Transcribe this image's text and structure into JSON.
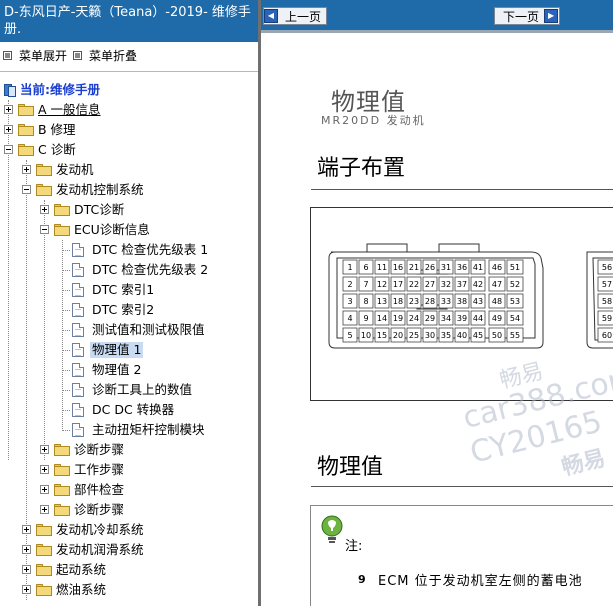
{
  "left_panel": {
    "title": "D-东风日产-天籁（Teana）-2019- 维修手册.",
    "menu": {
      "expand_label": "菜单展开",
      "collapse_label": "菜单折叠"
    },
    "tree": {
      "root_label": "当前:维修手册",
      "items": [
        {
          "label": "A 一般信息"
        },
        {
          "label": "B 修理"
        },
        {
          "label": "C 诊断"
        },
        {
          "label": "发动机"
        },
        {
          "label": "发动机控制系统"
        },
        {
          "label": "DTC诊断"
        },
        {
          "label": "ECU诊断信息"
        },
        {
          "label": "DTC 检查优先级表 1"
        },
        {
          "label": "DTC 检查优先级表 2"
        },
        {
          "label": "DTC 索引1"
        },
        {
          "label": "DTC 索引2"
        },
        {
          "label": "测试值和测试极限值"
        },
        {
          "label": "物理值 1"
        },
        {
          "label": "物理值 2"
        },
        {
          "label": "诊断工具上的数值"
        },
        {
          "label": "DC DC 转换器"
        },
        {
          "label": "主动扭矩杆控制模块"
        },
        {
          "label": "诊断步骤"
        },
        {
          "label": "工作步骤"
        },
        {
          "label": "部件检查"
        },
        {
          "label": "诊断步骤"
        },
        {
          "label": "发动机冷却系统"
        },
        {
          "label": "发动机润滑系统"
        },
        {
          "label": "起动系统"
        },
        {
          "label": "燃油系统"
        }
      ]
    }
  },
  "nav": {
    "prev_label": "上一页",
    "next_label": "下一页"
  },
  "document": {
    "title": "物理值",
    "subtitle": "MR20DD 发动机",
    "section_terminal": "端子布置",
    "section_physical": "物理值",
    "connector_left_pins": [
      [
        "1",
        "6",
        "11",
        "16",
        "21",
        "26",
        "31",
        "36",
        "41",
        "46",
        "51"
      ],
      [
        "2",
        "7",
        "12",
        "17",
        "22",
        "27",
        "32",
        "37",
        "42",
        "47",
        "52"
      ],
      [
        "3",
        "8",
        "13",
        "18",
        "23",
        "28",
        "33",
        "38",
        "43",
        "48",
        "53"
      ],
      [
        "4",
        "9",
        "14",
        "19",
        "24",
        "29",
        "34",
        "39",
        "44",
        "49",
        "54"
      ],
      [
        "5",
        "10",
        "15",
        "20",
        "25",
        "30",
        "35",
        "40",
        "45",
        "50",
        "55"
      ]
    ],
    "connector_right_pins": [
      "56",
      "57",
      "58",
      "59",
      "60"
    ],
    "note_label": "注:",
    "note_bullet": "9",
    "note_text": "ECM 位于发动机室左侧的蓄电池"
  },
  "watermark": {
    "line1": "畅易",
    "line2": "car388.com",
    "line3": "CY20165",
    "line4": "畅易"
  }
}
